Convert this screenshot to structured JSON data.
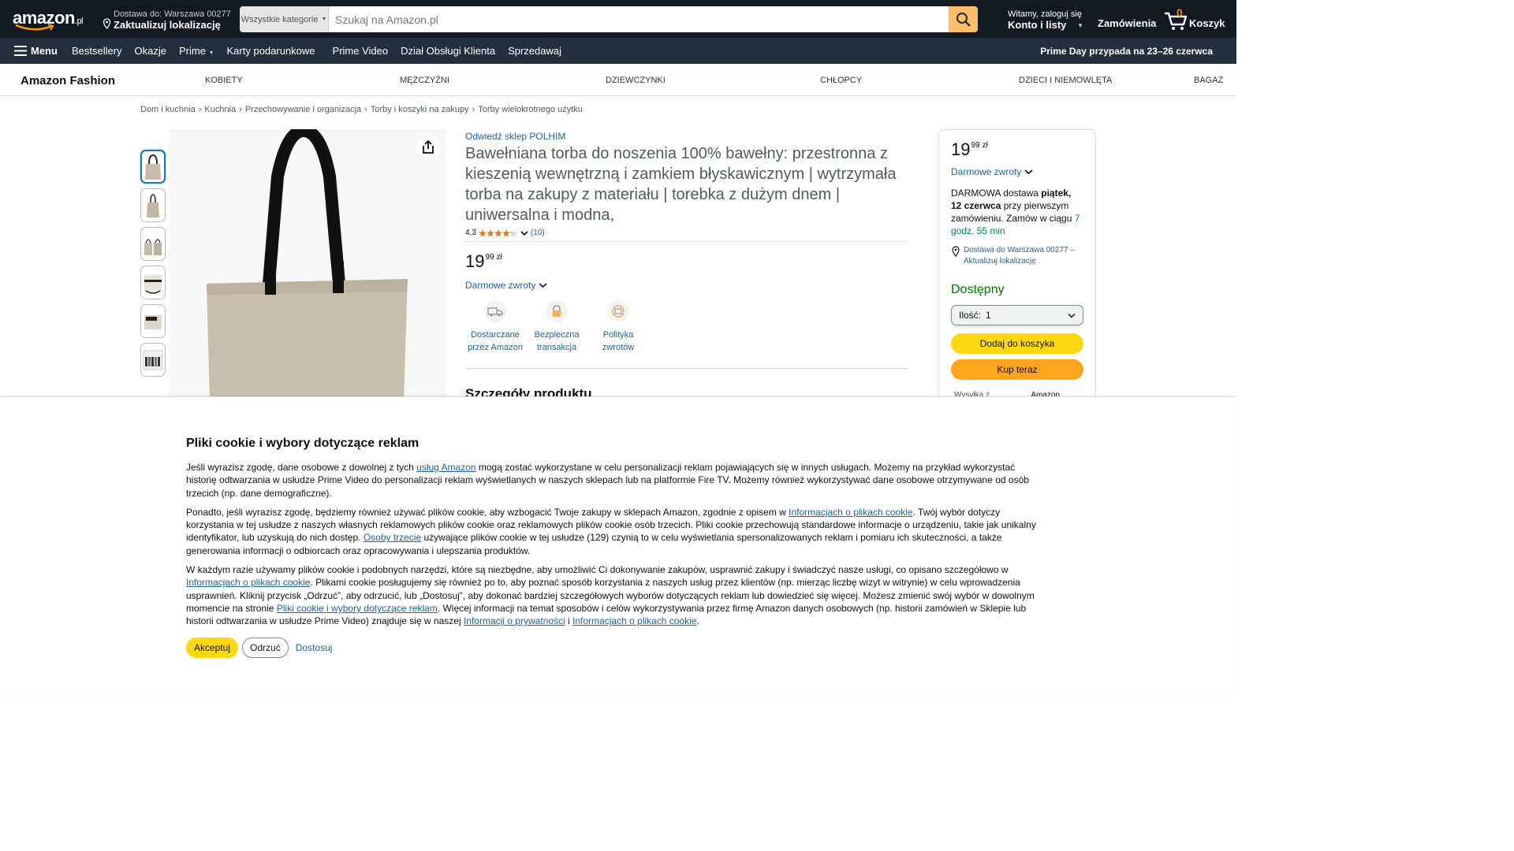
{
  "header": {
    "logo_text": "amazon",
    "logo_tld": ".pl",
    "deliver_line1": "Dostawa do: Warszawa 00277",
    "deliver_line2": "Zaktualizuj lokalizację",
    "search_category": "Wszystkie kategorie",
    "search_placeholder": "Szukaj na Amazon.pl",
    "account_line1": "Witamy, zaloguj się",
    "account_line2": "Konto i listy",
    "orders": "Zamówienia",
    "cart_count": "0",
    "cart_label": "Koszyk"
  },
  "subnav": {
    "menu": "Menu",
    "items": [
      "Bestsellery",
      "Okazje",
      "Prime",
      "Karty podarunkowe",
      "Prime Video",
      "Dział Obsługi Klienta",
      "Sprzedawaj"
    ],
    "promo": "Prime Day przypada na 23–26 czerwca"
  },
  "fashion": {
    "brand": "Amazon Fashion",
    "categories": [
      "KOBIETY",
      "MĘŻCZYŹNI",
      "DZIEWCZYNKI",
      "CHŁOPCY",
      "DZIECI I NIEMOWLĘTA",
      "BAGAŻ"
    ]
  },
  "breadcrumb": [
    "Dom i kuchnia",
    "Kuchnia",
    "Przechowywanie i organizacja",
    "Torby i koszyki na zakupy",
    "Torby wielokrotnego użytku"
  ],
  "product": {
    "store_link": "Odwiedź sklep POLHIM",
    "title": "Bawełniana torba do noszenia 100% bawełny: przestronna z kieszenią wewnętrzną i zamkiem błyskawicznym | wytrzymała torba na zakupy z materiału | torebka z dużym dnem | uniwersalna i modna,",
    "rating": "4,3",
    "rating_value": 4.3,
    "review_count": "(10)",
    "price_whole": "19",
    "price_fraction": "99",
    "price_currency": "zł",
    "returns": "Darmowe zwroty",
    "badges": [
      "Dostarczane przez Amazon",
      "Bezpieczna transakcja",
      "Polityka zwrotów"
    ],
    "details_heading": "Szczegóły produktu",
    "thumbnail_count": 6
  },
  "buybox": {
    "price_whole": "19",
    "price_fraction": "99",
    "price_currency": "zł",
    "returns": "Darmowe zwroty",
    "delivery_pre": "DARMOWA dostawa",
    "delivery_date": "piątek, 12 czerwca",
    "delivery_mid": "przy pierwszym zamówieniu. Zamów w ciągu",
    "delivery_countdown": "7 godz. 55 min",
    "location": "Dostawa do Warszawa 00277 – Aktualizuj lokalizację",
    "availability": "Dostępny",
    "qty_label": "Ilość:",
    "qty_value": "1",
    "add_to_cart": "Dodaj do koszyka",
    "buy_now": "Kup teraz",
    "ships_from_label": "Wysyłka z",
    "ships_from_value": "Amazon"
  },
  "cookie": {
    "title": "Pliki cookie i wybory dotyczące reklam",
    "p1_a": "Jeśli wyrazisz zgodę, dane osobowe z dowolnej z tych ",
    "p1_link": "usług Amazon",
    "p1_b": " mogą zostać wykorzystane w celu personalizacji reklam pojawiających się w innych usługach. Możemy na przykład wykorzystać historię odtwarzania w usłudze Prime Video do personalizacji reklam wyświetlanych w naszych sklepach lub na platformie Fire TV. Możemy również wykorzystywać dane osobowe otrzymywane od osób trzecich (np. dane demograficzne).",
    "p2_a": "Ponadto, jeśli wyrazisz zgodę, będziemy również używać plików cookie, aby wzbogacić Twoje zakupy w sklepach Amazon, zgodnie z opisem w ",
    "p2_link1": "Informacjach o plikach cookie",
    "p2_b": ". Twój wybór dotyczy korzystania w tej usłudze z naszych własnych reklamowych plików cookie oraz reklamowych plików cookie osób trzecich. Pliki cookie przechowują standardowe informacje o urządzeniu, takie jak unikalny identyfikator, lub uzyskują do nich dostęp. ",
    "p2_link2": "Osoby trzecie",
    "p2_c": " używające plików cookie w tej usłudze (129) czynią to w celu wyświetlania spersonalizowanych reklam i pomiaru ich skuteczności, a także generowania informacji o odbiorcach oraz opracowywania i ulepszania produktów.",
    "p3_a": "W każdym razie używamy plików cookie i podobnych narzędzi, które są niezbędne, aby umożliwić Ci dokonywanie zakupów, usprawnić zakupy i świadczyć nasze usługi, co opisano szczegółowo w ",
    "p3_link1": "Informacjach o plikach cookie",
    "p3_b": ". Plikami cookie posługujemy się również po to, aby poznać sposób korzystania z naszych usług przez klientów (np. mierząc liczbę wizyt w witrynie) w celu wprowadzenia usprawnień. Kliknij przycisk „Odrzuć”, aby odrzucić, lub „Dostosuj”, aby dokonać bardziej szczegółowych wyborów dotyczących reklam lub dowiedzieć się więcej. Możesz zmienić swój wybór w dowolnym momencie na stronie ",
    "p3_link2": "Pliki cookie i wybory dotyczące reklam",
    "p3_c": ". Więcej informacji na temat sposobów i celów wykorzystywania przez firmę Amazon danych osobowych (np. historii zamówień w Sklepie lub historii odtwarzania w usłudze Prime Video) znajduje się w naszej ",
    "p3_link3": "Informacji o prywatności",
    "p3_d": " i ",
    "p3_link4": "Informacjach o plikach cookie",
    "p3_e": ".",
    "accept": "Akceptuj",
    "reject": "Odrzuć",
    "customize": "Dostosuj"
  }
}
